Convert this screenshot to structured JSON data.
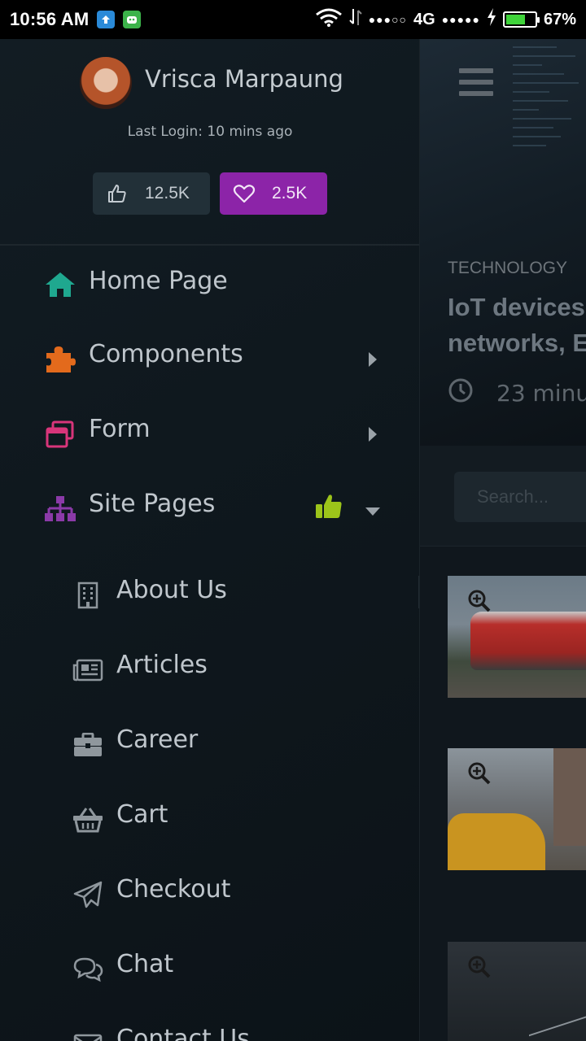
{
  "status_bar": {
    "time": "10:56 AM",
    "network": "4G",
    "battery_percent": "67%",
    "battery_level": 0.67
  },
  "drawer": {
    "user": {
      "name": "Vrisca Marpaung",
      "last_login": "Last Login: 10 mins ago"
    },
    "stats": {
      "likes": "12.5K",
      "loves": "2.5K"
    },
    "menu": [
      {
        "label": "Home Page",
        "icon": "home-icon",
        "color": "#1fa88f"
      },
      {
        "label": "Components",
        "icon": "puzzle-icon",
        "color": "#e36a1c"
      },
      {
        "label": "Form",
        "icon": "window-restore-icon",
        "color": "#d8357a"
      },
      {
        "label": "Site Pages",
        "icon": "sitemap-icon",
        "color": "#8b3aa8",
        "badge_color": "#9cc41a"
      }
    ],
    "submenu": [
      {
        "label": "About Us",
        "icon": "building-icon"
      },
      {
        "label": "Articles",
        "icon": "newspaper-icon"
      },
      {
        "label": "Career",
        "icon": "briefcase-icon"
      },
      {
        "label": "Cart",
        "icon": "basket-icon"
      },
      {
        "label": "Checkout",
        "icon": "paper-plane-icon"
      },
      {
        "label": "Chat",
        "icon": "comments-icon"
      },
      {
        "label": "Contact Us",
        "icon": "envelope-icon"
      }
    ]
  },
  "main": {
    "hero": {
      "category": "TECHNOLOGY",
      "title": "IoT devices networks, E",
      "time": "23 minu"
    },
    "search": {
      "placeholder": "Search..."
    }
  }
}
